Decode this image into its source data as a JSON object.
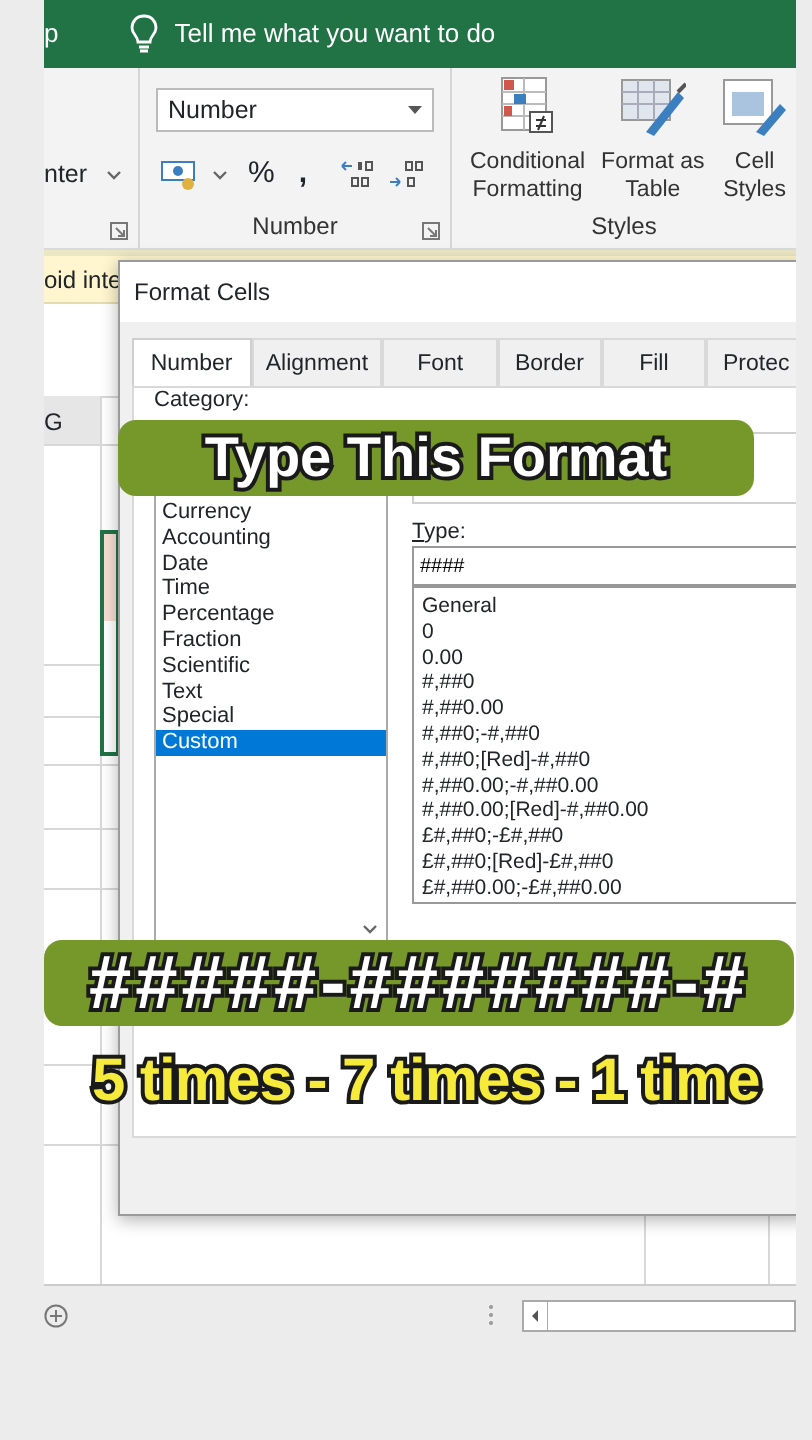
{
  "title_bar": {
    "tab_partial": "p",
    "tell_me": "Tell me what you want to do"
  },
  "ribbon": {
    "alignment_partial": "nter",
    "number_format": "Number",
    "percent": "%",
    "comma": ",",
    "number_group_label": "Number",
    "styles_buttons": [
      {
        "lines": [
          "Conditional",
          "Formatting"
        ],
        "kind": "conditional"
      },
      {
        "lines": [
          "Format as",
          "Table"
        ],
        "kind": "table"
      },
      {
        "lines": [
          "Cell",
          "Styles"
        ],
        "kind": "cell"
      }
    ],
    "styles_group_label": "Styles"
  },
  "message_bar": {
    "text": "oid inte"
  },
  "sheet": {
    "column_header": "G"
  },
  "dialog": {
    "title": "Format Cells",
    "tabs": [
      {
        "label": "Number",
        "selected": true
      },
      {
        "label": "Alignment",
        "selected": false
      },
      {
        "label": "Font",
        "selected": false
      },
      {
        "label": "Border",
        "selected": false
      },
      {
        "label": "Fill",
        "selected": false
      },
      {
        "label": "Protec",
        "selected": false
      }
    ],
    "category_label": "Category:",
    "categories": [
      {
        "label": "Currency",
        "selected": false
      },
      {
        "label": "Accounting",
        "selected": false
      },
      {
        "label": "Date",
        "selected": false
      },
      {
        "label": "Time",
        "selected": false
      },
      {
        "label": "Percentage",
        "selected": false
      },
      {
        "label": "Fraction",
        "selected": false
      },
      {
        "label": "Scientific",
        "selected": false
      },
      {
        "label": "Text",
        "selected": false
      },
      {
        "label": "Special",
        "selected": false
      },
      {
        "label": "Custom",
        "selected": true
      }
    ],
    "type_label": "Type:",
    "type_value": "####",
    "types": [
      "General",
      "0",
      "0.00",
      "#,##0",
      "#,##0.00",
      "#,##0;-#,##0",
      "#,##0;[Red]-#,##0",
      "#,##0.00;-#,##0.00",
      "#,##0.00;[Red]-#,##0.00",
      "£#,##0;-£#,##0",
      "£#,##0;[Red]-£#,##0",
      "£#,##0.00;-£#,##0.00"
    ]
  },
  "captions": [
    {
      "kind": "banner",
      "text": "Type This Format"
    },
    {
      "kind": "banner",
      "text": "#####-#######-#"
    },
    {
      "kind": "subtitle",
      "text": "5 times - 7 times - 1 time"
    }
  ]
}
